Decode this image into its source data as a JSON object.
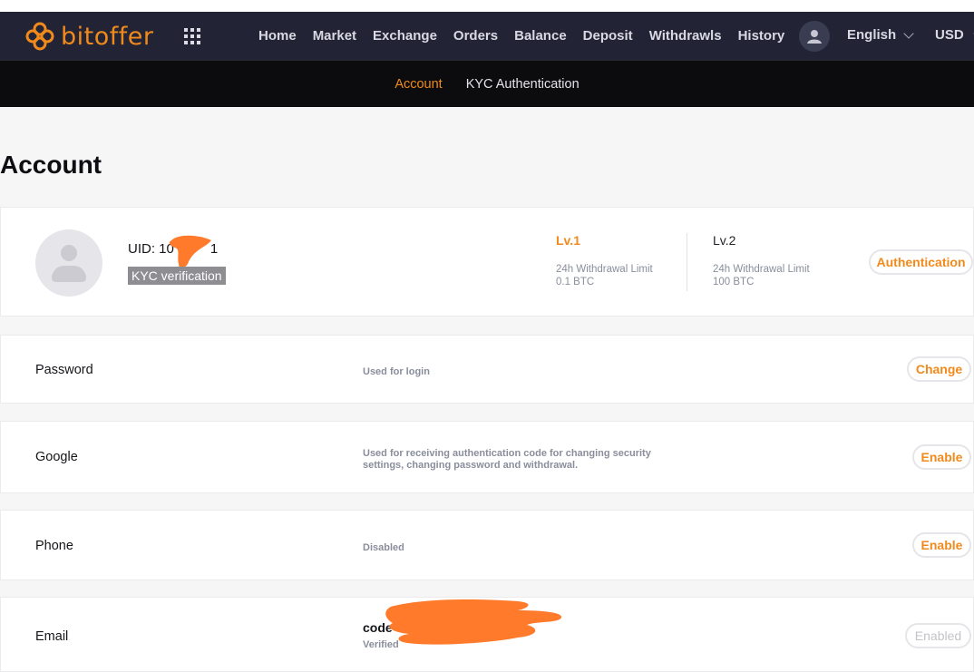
{
  "brand": {
    "name": "bitoffer",
    "accent": "#f08a1c"
  },
  "nav": {
    "items": [
      "Home",
      "Market",
      "Exchange",
      "Orders",
      "Balance",
      "Deposit",
      "Withdrawls",
      "History"
    ],
    "language": "English",
    "currency": "USD",
    "icons": [
      "apps-grid-icon",
      "user-icon",
      "chevron-down-icon"
    ]
  },
  "subnav": {
    "account": "Account",
    "kyc": "KYC Authentication",
    "active": "Account"
  },
  "page": {
    "title": "Account"
  },
  "profile": {
    "uid": "UID: 10",
    "uid_end": "1",
    "kyc_badge": "KYC verification",
    "lv1": {
      "label": "Lv.1",
      "limit_label": "24h Withdrawal Limit",
      "limit_value": "0.1 BTC"
    },
    "lv2": {
      "label": "Lv.2",
      "limit_label": "24h Withdrawal Limit",
      "limit_value": "100 BTC"
    },
    "auth_button": "Authentication"
  },
  "security": {
    "password": {
      "label": "Password",
      "desc": "Used for login",
      "button": "Change"
    },
    "google": {
      "label": "Google",
      "desc_line1": "Used for receiving authentication code for changing security",
      "desc_line2": "settings, changing password and withdrawal.",
      "button": "Enable"
    },
    "phone": {
      "label": "Phone",
      "desc": "Disabled",
      "button": "Enable"
    },
    "email": {
      "label": "Email",
      "value": "code",
      "status": "Verified",
      "button": "Enabled"
    }
  }
}
